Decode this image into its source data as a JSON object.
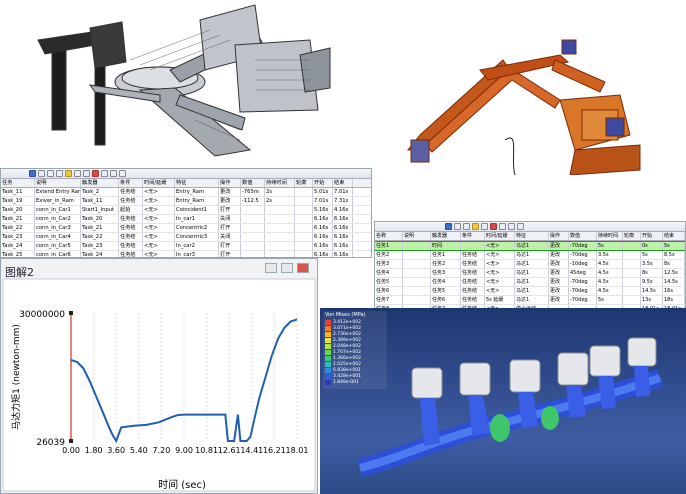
{
  "table1": {
    "columns": [
      "任务",
      "说明",
      "触发器",
      "条件",
      "时间/延缓",
      "特征",
      "操作",
      "数值",
      "持续时间",
      "轮廓",
      "开始",
      "结束"
    ],
    "column_groups": [
      "触发器",
      "操作",
      "时间"
    ],
    "rows": [
      [
        "Task_11",
        "Extend Entry Ram",
        "Task_2",
        "任务结",
        "<无>",
        "Entry_Ram",
        "更改",
        "-765m",
        "2s",
        "",
        "5.01s",
        "7.01s"
      ],
      [
        "Task_19",
        "Exiver_in_Ram",
        "Task_11",
        "任务结",
        "<无>",
        "Entry_Ram",
        "更改",
        "-112.5",
        "2s",
        "",
        "7.01s",
        "7.31s"
      ],
      [
        "Task_20",
        "conn_in_Car1",
        "Start1_Input",
        "起始",
        "<无>",
        "Coincident1",
        "打开",
        "",
        "",
        "",
        "5.16s",
        "4.16s"
      ],
      [
        "Task_21",
        "conn_in_Car2",
        "Task_20",
        "任务结",
        "<无>",
        "In_car1",
        "关闭",
        "",
        "",
        "",
        "6.16s",
        "6.16s"
      ],
      [
        "Task_22",
        "conn_in_Car3",
        "Task_21",
        "任务结",
        "<无>",
        "Concentric2",
        "打开",
        "",
        "",
        "",
        "6.16s",
        "6.16s"
      ],
      [
        "Task_23",
        "conn_in_Car4",
        "Task_22",
        "任务结",
        "<无>",
        "Concentric3",
        "关闭",
        "",
        "",
        "",
        "6.16s",
        "6.16s"
      ],
      [
        "Task_24",
        "conn_in_Car5",
        "Task_23",
        "任务结",
        "<无>",
        "In_car2",
        "打开",
        "",
        "",
        "",
        "6.16s",
        "6.16s"
      ],
      [
        "Task_25",
        "conn_in_Car6",
        "Task_24",
        "任务结",
        "<无>",
        "In_car3",
        "打开",
        "",
        "",
        "",
        "6.16s",
        "6.16s"
      ],
      [
        "Task_26",
        "Retract Entry Ram",
        "Task_19",
        "任务结",
        "<无>",
        "Entry_Ram",
        "更改",
        "765mm",
        "2s",
        "",
        "8.16s",
        "10.16s"
      ]
    ]
  },
  "table2": {
    "columns": [
      "名称",
      "说明",
      "触发器",
      "条件",
      "时间/延缓",
      "特征",
      "操作",
      "数值",
      "持续时间",
      "轮廓",
      "开始",
      "结束"
    ],
    "rows": [
      [
        "任务1",
        "",
        "时间",
        "",
        "<无>",
        "马达1",
        "更改",
        "-70deg",
        "5s",
        "",
        "0s",
        "5s"
      ],
      [
        "任务2",
        "",
        "任务1",
        "任务结",
        "<无>",
        "马达1",
        "更改",
        "-70deg",
        "3.5s",
        "",
        "5s",
        "8.5s"
      ],
      [
        "任务3",
        "",
        "任务2",
        "任务结",
        "<无>",
        "马达1",
        "更改",
        "-10deg",
        "4.5s",
        "",
        "3.5s",
        "8s"
      ],
      [
        "任务4",
        "",
        "任务3",
        "任务结",
        "<无>",
        "马达1",
        "更改",
        "45deg",
        "4.5s",
        "",
        "8s",
        "12.5s"
      ],
      [
        "任务5",
        "",
        "任务4",
        "任务结",
        "<无>",
        "马达1",
        "更改",
        "-70deg",
        "4.5s",
        "",
        "9.5s",
        "14.5s"
      ],
      [
        "任务6",
        "",
        "任务5",
        "任务结",
        "<无>",
        "马达1",
        "更改",
        "-70deg",
        "4.5s",
        "",
        "14.5s",
        "16s"
      ],
      [
        "任务7",
        "",
        "任务6",
        "任务结",
        "5s 延缓",
        "马达1",
        "更改",
        "-70deg",
        "5s",
        "",
        "13s",
        "18s"
      ],
      [
        "任务8",
        "",
        "任务7",
        "任务结",
        "<无>",
        "停止运动",
        "",
        "",
        "",
        "",
        "18.01s",
        "18.01s"
      ]
    ]
  },
  "plot": {
    "window_title": "图解2",
    "ylabel": "马达力矩1 (newton-mm)",
    "xlabel": "时间 (sec)",
    "y_top_label": "30000000",
    "y_bottom_label": "26039",
    "x_ticks": [
      "0.00",
      "1.80",
      "3.60",
      "5.40",
      "7.20",
      "9.00",
      "10.81",
      "12.61",
      "14.41",
      "16.21",
      "18.01"
    ]
  },
  "chart_data": {
    "type": "line",
    "xlabel": "时间 (sec)",
    "ylabel": "马达力矩1 (newton-mm)",
    "xlim": [
      0,
      18.01
    ],
    "ylim": [
      26039,
      30000000
    ],
    "x": [
      0,
      0.5,
      1,
      1.5,
      2,
      2.5,
      3,
      3.3,
      3.6,
      4,
      5,
      6,
      7,
      8,
      8.5,
      9,
      10,
      11,
      12,
      12.3,
      12.5,
      12.8,
      13,
      13.3,
      13.5,
      14,
      14.3,
      14.6,
      15,
      15.5,
      16,
      16.5,
      17,
      17.5,
      18.01
    ],
    "values": [
      19000000,
      18500000,
      17000000,
      14000000,
      10500000,
      7000000,
      3500000,
      1500000,
      30000,
      3200000,
      3600000,
      3800000,
      4400000,
      5600000,
      6100000,
      6200000,
      6200000,
      6200000,
      6200000,
      6200000,
      30000,
      30000,
      30000,
      6200000,
      30000,
      30000,
      1000000,
      5000000,
      10000000,
      15000000,
      20000000,
      24000000,
      26500000,
      28000000,
      28500000
    ]
  },
  "legend": {
    "title": "Von Mises (MPa)",
    "values": [
      "3.412e+002",
      "3.071e+002",
      "2.730e+002",
      "2.389e+002",
      "2.048e+002",
      "1.707e+002",
      "1.366e+002",
      "1.025e+002",
      "6.838e+001",
      "3.428e+001",
      "1.849e-001"
    ],
    "colors": [
      "#e8413a",
      "#f07a2a",
      "#f7b52a",
      "#e9e33a",
      "#b4e23d",
      "#6ed84a",
      "#3cc97a",
      "#2dbcbc",
      "#2a8de0",
      "#2f5fd6",
      "#2a3ab8"
    ]
  }
}
